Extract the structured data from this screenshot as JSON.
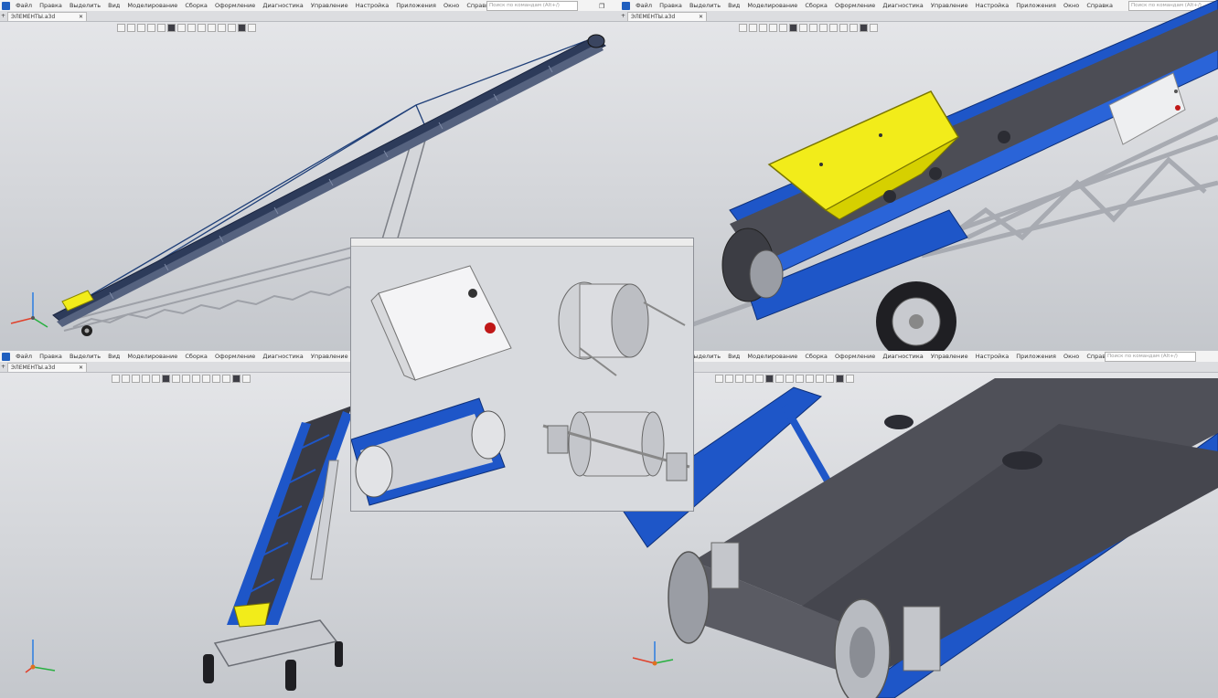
{
  "menu": [
    "Файл",
    "Правка",
    "Выделить",
    "Вид",
    "Моделирование",
    "Сборка",
    "Оформление",
    "Диагностика",
    "Управление",
    "Настройка",
    "Приложения",
    "Окно",
    "Справка"
  ],
  "tab_title": "ЭЛЕМЕНТЫ.a3d",
  "tab_close": "✕",
  "tab_plus": "+",
  "search_placeholder": "Поиск по командам (Alt+/)",
  "search_icon": "search-icon",
  "win_controls": [
    "—",
    "❐",
    "✕"
  ],
  "colors": {
    "frame_blue": "#1e56c8",
    "hopper_yellow": "#f2ec1a",
    "belt_gray": "#4c4d55",
    "truss_gray": "#b8bbc2"
  },
  "panes": [
    {
      "id": "top-left",
      "view": "full conveyor side view"
    },
    {
      "id": "top-right",
      "view": "hopper close-up"
    },
    {
      "id": "bottom-left",
      "view": "inclined conveyor front view"
    },
    {
      "id": "bottom-right",
      "view": "drive drum close-up"
    }
  ],
  "inset_parts": [
    "control box",
    "motor drum",
    "drum cross-section",
    "tail drum"
  ]
}
